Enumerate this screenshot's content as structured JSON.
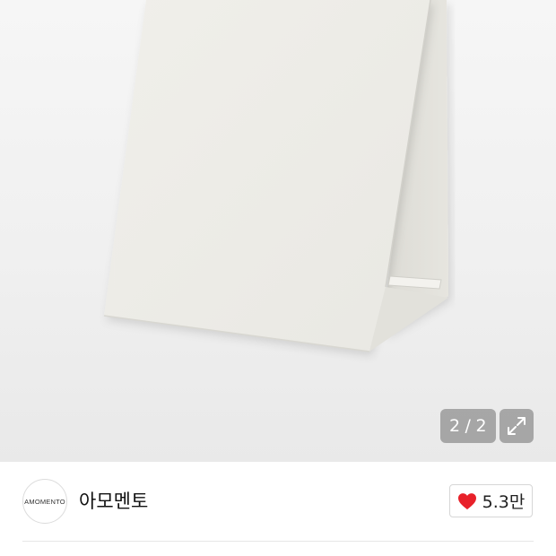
{
  "gallery": {
    "image_alt": "product-scarf-image",
    "counter": {
      "current": "2",
      "separator": "/",
      "total": "2"
    },
    "expand_icon": "expand-arrows-icon"
  },
  "brand": {
    "logo_text": "AMOMENTO",
    "name": "아모멘토"
  },
  "like": {
    "icon": "heart-icon",
    "count": "5.3만",
    "heart_color": "#e8212a"
  }
}
